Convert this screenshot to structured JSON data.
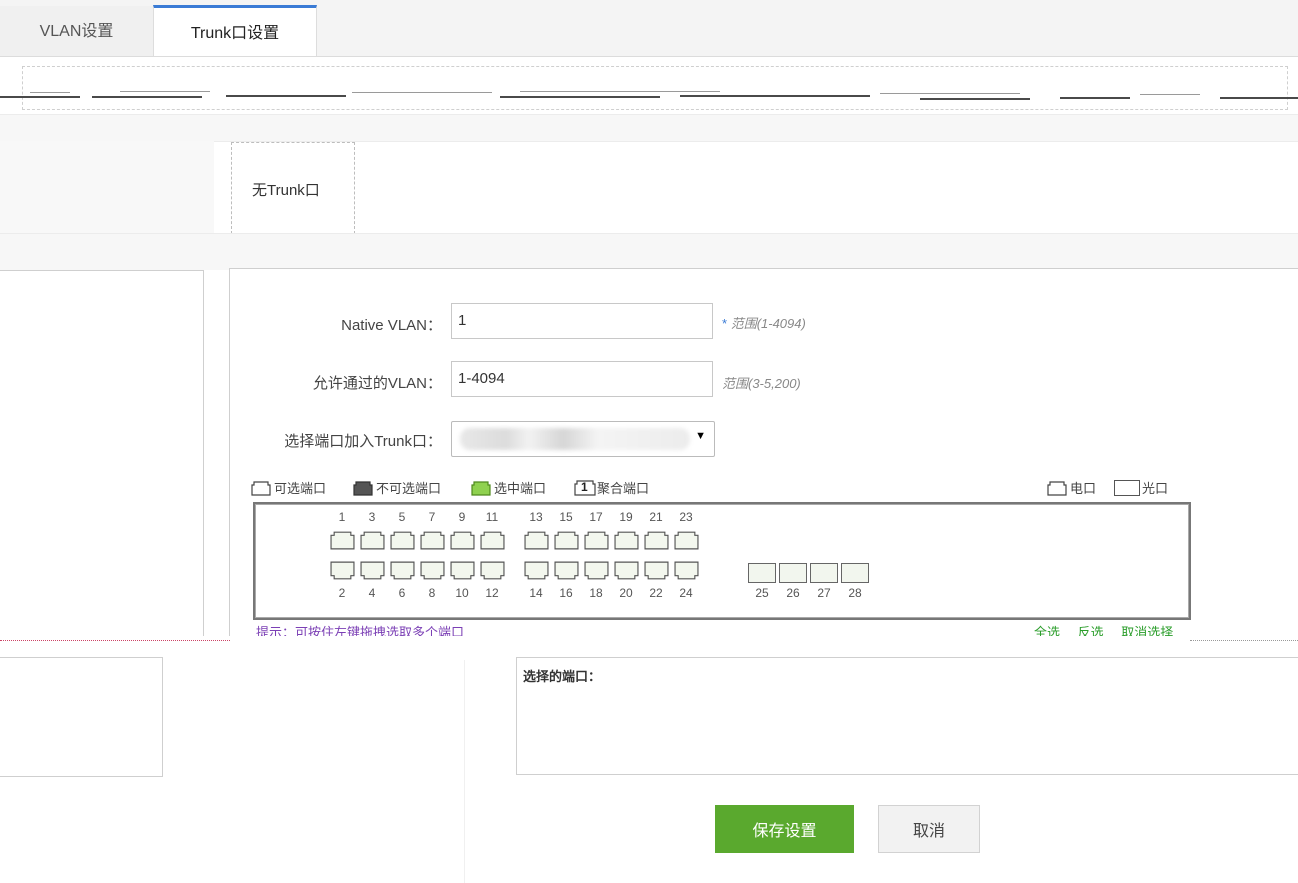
{
  "tabs": [
    {
      "label": "VLAN设置",
      "active": false
    },
    {
      "label": "Trunk口设置",
      "active": true
    }
  ],
  "trunk_list": {
    "empty_text": "无Trunk口"
  },
  "form": {
    "native_vlan": {
      "label": "Native VLAN：",
      "value": "1",
      "required_mark": "*",
      "hint": "范围(1-4094)"
    },
    "allowed_vlan": {
      "label": "允许通过的VLAN：",
      "value": "1-4094",
      "hint": "范围(3-5,200)"
    },
    "port_select": {
      "label": "选择端口加入Trunk口：",
      "value": ""
    }
  },
  "legend": {
    "selectable": "可选端口",
    "unselectable": "不可选端口",
    "selected": "选中端口",
    "aggregated": "聚合端口",
    "aggregated_num": "1",
    "electric": "电口",
    "optical": "光口"
  },
  "ports": {
    "top_row": [
      "1",
      "3",
      "5",
      "7",
      "9",
      "11",
      "13",
      "15",
      "17",
      "19",
      "21",
      "23"
    ],
    "bottom_row": [
      "2",
      "4",
      "6",
      "8",
      "10",
      "12",
      "14",
      "16",
      "18",
      "20",
      "22",
      "24"
    ],
    "fiber": [
      "25",
      "26",
      "27",
      "28"
    ]
  },
  "tip": "提示：可按住左键拖拽选取多个端口",
  "select_actions": {
    "all": "全选",
    "invert": "反选",
    "cancel": "取消选择"
  },
  "selected_ports": {
    "label": "选择的端口："
  },
  "buttons": {
    "save": "保存设置",
    "cancel": "取消"
  },
  "colors": {
    "accent_tab": "#3a7bd5",
    "save": "#5aa92e",
    "selected_port": "#8fd14f",
    "unselectable_port": "#555555",
    "tip_text": "#7b3fb5",
    "action_link": "#2a9d2a"
  }
}
